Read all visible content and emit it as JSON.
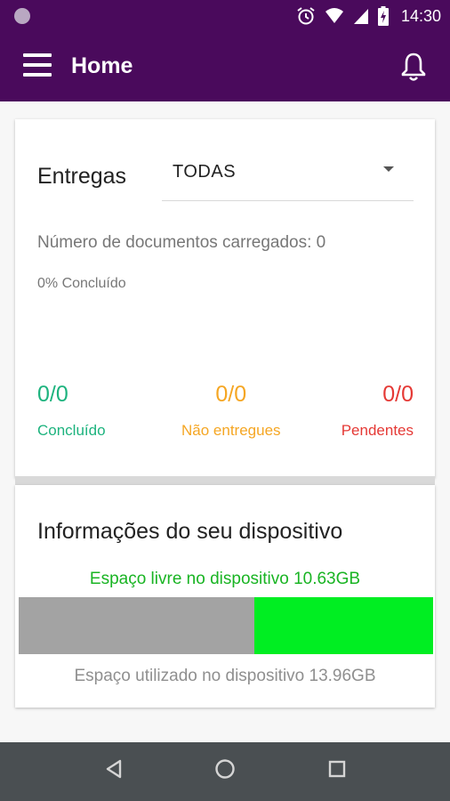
{
  "status_bar": {
    "time": "14:30"
  },
  "app_bar": {
    "title": "Home"
  },
  "deliveries": {
    "label": "Entregas",
    "filter_value": "TODAS",
    "documents_loaded": "Número de documentos carregados: 0",
    "percent_done": "0% Concluído",
    "stats": [
      {
        "value": "0/0",
        "label": "Concluído",
        "color": "#1db37e"
      },
      {
        "value": "0/0",
        "label": "Não entregues",
        "color": "#f5a623"
      },
      {
        "value": "0/0",
        "label": "Pendentes",
        "color": "#e53935"
      }
    ]
  },
  "device": {
    "title": "Informações do seu dispositivo",
    "free_space": "Espaço livre no dispositivo 10.63GB",
    "used_space": "Espaço utilizado no dispositivo 13.96GB",
    "used_fraction": 0.568,
    "used_color": "#a3a3a3",
    "free_color": "#00ee22"
  },
  "colors": {
    "primary": "#4a0a5c",
    "nav": "#4a4f52"
  },
  "icons": [
    "menu-icon",
    "bell-icon",
    "alarm-icon",
    "wifi-icon",
    "signal-icon",
    "battery-icon",
    "back-icon",
    "home-icon",
    "recents-icon"
  ]
}
